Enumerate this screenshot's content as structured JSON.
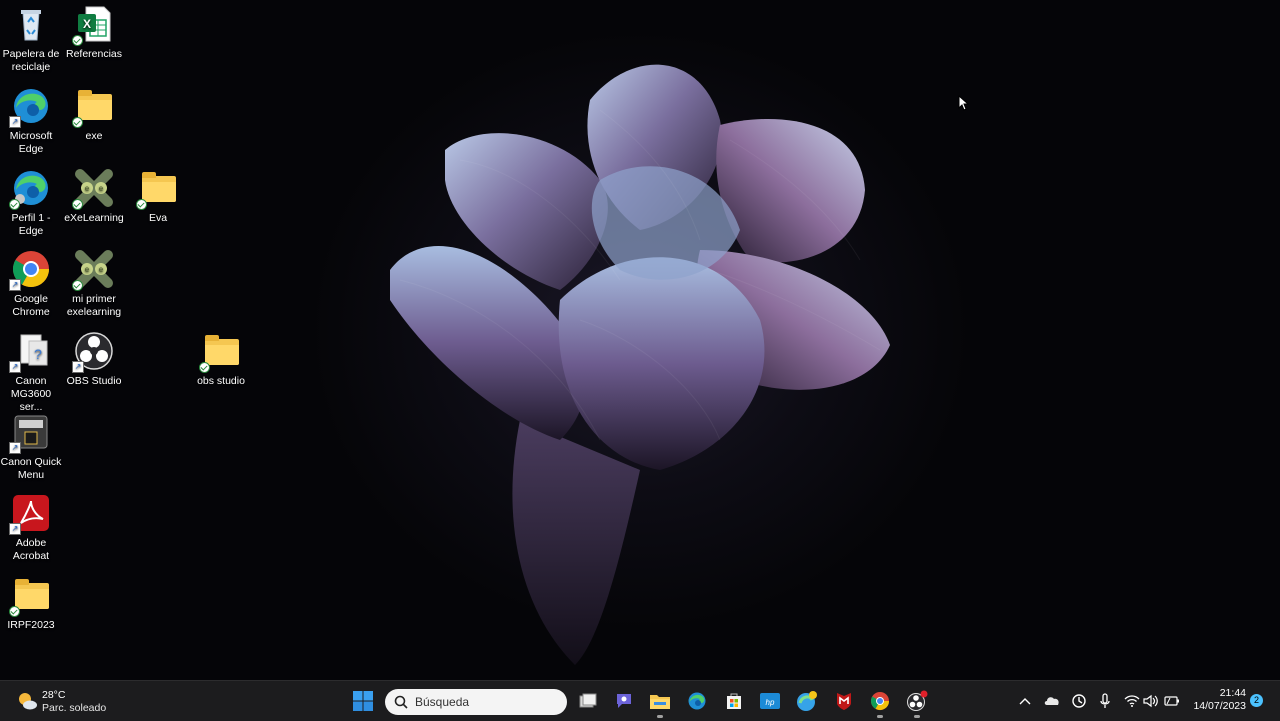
{
  "desktop": {
    "icons": [
      {
        "label": "Papelera de reciclaje",
        "icon": "recycle-bin-icon"
      },
      {
        "label": "Referencias",
        "icon": "excel-file-icon"
      },
      {
        "label": "Microsoft Edge",
        "icon": "edge-icon"
      },
      {
        "label": "exe",
        "icon": "folder-icon"
      },
      {
        "label": "Perfil 1 - Edge",
        "icon": "edge-profile-icon"
      },
      {
        "label": "eXeLearning",
        "icon": "exelearning-icon"
      },
      {
        "label": "Eva",
        "icon": "folder-icon"
      },
      {
        "label": "Google Chrome",
        "icon": "chrome-icon"
      },
      {
        "label": "mi primer exelearning",
        "icon": "exelearning-icon"
      },
      {
        "label": "Canon MG3600 ser...",
        "icon": "printer-icon"
      },
      {
        "label": "OBS Studio",
        "icon": "obs-icon"
      },
      {
        "label": "obs studio",
        "icon": "folder-icon"
      },
      {
        "label": "Canon Quick Menu",
        "icon": "canon-quick-menu-icon"
      },
      {
        "label": "Adobe Acrobat",
        "icon": "acrobat-icon"
      },
      {
        "label": "IRPF2023",
        "icon": "folder-icon"
      }
    ]
  },
  "taskbar": {
    "weather": {
      "temp": "28°C",
      "condition": "Parc. soleado"
    },
    "search": {
      "placeholder": "Búsqueda"
    },
    "apps": [
      "start-icon",
      "task-view-icon",
      "teams-chat-icon",
      "file-explorer-icon",
      "edge-icon",
      "microsoft-store-icon",
      "hp-smart-icon",
      "edge-beta-icon",
      "mcafee-icon",
      "chrome-icon",
      "obs-icon"
    ],
    "tray": [
      "chevron-up-icon",
      "onedrive-icon",
      "sync-icon",
      "microphone-icon",
      "wifi-icon",
      "speaker-icon",
      "battery-icon"
    ],
    "clock": {
      "time": "21:44",
      "date": "14/07/2023"
    },
    "notifications": "2"
  },
  "colors": {
    "taskbar": "#1c1c1e",
    "accent": "#4cc2ff",
    "folder": "#f5c751"
  }
}
